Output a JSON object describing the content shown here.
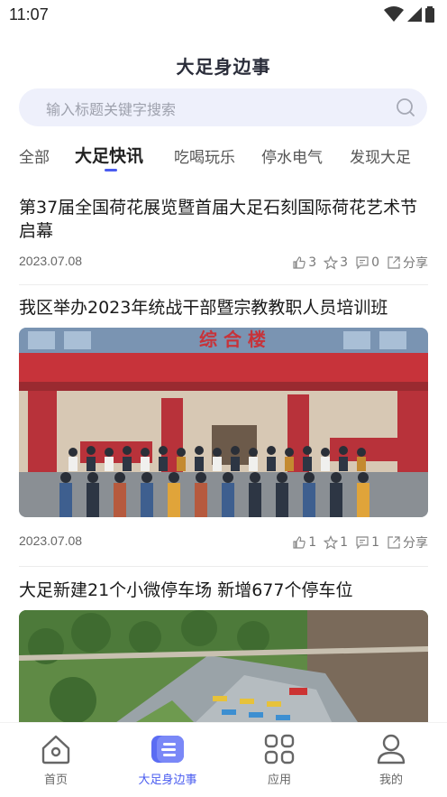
{
  "status_bar": {
    "time": "11:07",
    "icons": [
      "wifi-icon",
      "signal-icon",
      "battery-icon"
    ]
  },
  "app": {
    "logo_text": "大足身边事"
  },
  "search": {
    "placeholder": "输入标题关键字搜索"
  },
  "tabs": [
    {
      "label": "全部",
      "active": false
    },
    {
      "label": "大足快讯",
      "active": true
    },
    {
      "label": "吃喝玩乐",
      "active": false
    },
    {
      "label": "停水电气",
      "active": false
    },
    {
      "label": "发现大足",
      "active": false
    }
  ],
  "articles": [
    {
      "title": "第37届全国荷花展览暨首届大足石刻国际荷花艺术节启幕",
      "date": "2023.07.08",
      "likes": "3",
      "favorites": "3",
      "comments": "0",
      "share_label": "分享"
    },
    {
      "title": "我区举办2023年统战干部暨宗教教职人员培训班",
      "date": "2023.07.08",
      "likes": "1",
      "favorites": "1",
      "comments": "1",
      "share_label": "分享",
      "image": {
        "building_sign": "综 合 楼"
      }
    },
    {
      "title": "大足新建21个小微停车场 新增677个停车位",
      "image": {
        "subject": "parking-lot-aerial"
      }
    }
  ],
  "bottom_nav": [
    {
      "label": "首页",
      "icon": "home-icon",
      "active": false
    },
    {
      "label": "大足身边事",
      "icon": "app-logo-icon",
      "active": true
    },
    {
      "label": "应用",
      "icon": "apps-grid-icon",
      "active": false
    },
    {
      "label": "我的",
      "icon": "profile-icon",
      "active": false
    }
  ],
  "colors": {
    "accent": "#4a5cf0",
    "search_bg": "#eef0fb",
    "text": "#222222",
    "muted": "#777777"
  }
}
